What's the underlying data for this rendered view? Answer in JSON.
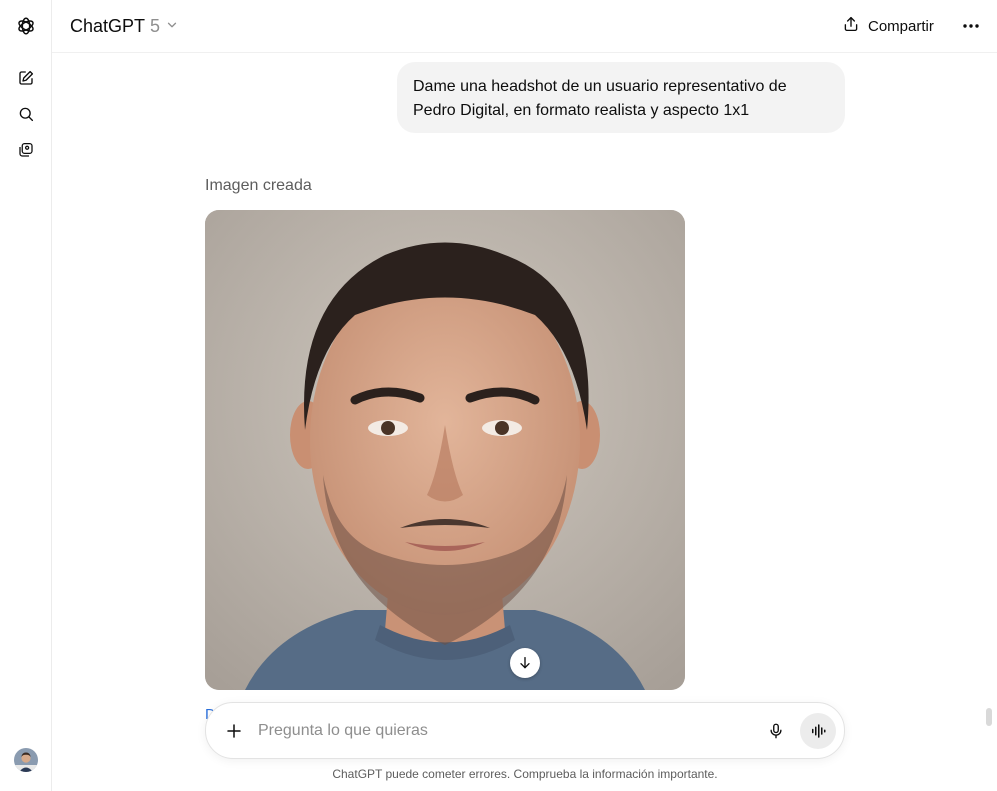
{
  "header": {
    "model_name": "ChatGPT",
    "model_version": "5",
    "share_label": "Compartir"
  },
  "sidebar": {
    "icons": [
      "openai-logo-icon",
      "new-chat-icon",
      "search-icon",
      "library-icon"
    ]
  },
  "conversation": {
    "user_message": "Dame una headshot de un usuario representativo de Pedro Digital, en formato realista y aspecto 1x1",
    "image_label": "Imagen creada",
    "partial_text": "D"
  },
  "composer": {
    "placeholder": "Pregunta lo que quieras"
  },
  "footer": {
    "disclaimer": "ChatGPT puede cometer errores. Comprueba la información importante."
  },
  "colors": {
    "user_bubble": "#f3f3f3",
    "voice_button": "#ececec",
    "muted_text": "#8f8f8f"
  }
}
